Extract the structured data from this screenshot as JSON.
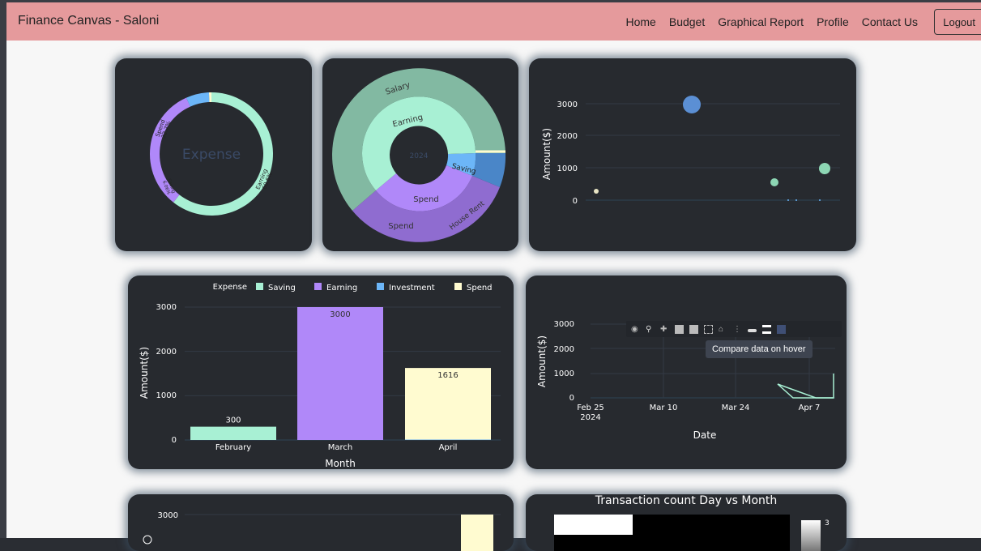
{
  "navbar": {
    "brand": "Finance Canvas - Saloni",
    "links": [
      "Home",
      "Budget",
      "Graphical Report",
      "Profile",
      "Contact Us"
    ],
    "logout": "Logout"
  },
  "charts": {
    "donut": {
      "center_label": "Expense",
      "slices": [
        {
          "label": "Earning",
          "pct": "60.6%",
          "value": 60.6,
          "color": "#a8f0d4"
        },
        {
          "label": "Spend",
          "pct": "32.7%",
          "value": 32.7,
          "color": "#b088f9"
        },
        {
          "label": "Saving",
          "pct": "6.06%",
          "value": 6.06,
          "color": "#6cb6f8"
        },
        {
          "label": "",
          "pct": "",
          "value": 0.64,
          "color": "#fffbd0"
        }
      ]
    },
    "sunburst": {
      "center_label": "2024",
      "labels": {
        "salary": "Salary",
        "earning": "Earning",
        "saving": "Saving",
        "spend_inner": "Spend",
        "spend_outer": "Spend",
        "house_rent": "House Rent"
      }
    },
    "bubble": {
      "ylabel": "Amount($)",
      "yticks": [
        "3000",
        "2000",
        "1000",
        "0"
      ]
    },
    "bar": {
      "legend_title": "Expense",
      "legend": [
        "Saving",
        "Earning",
        "Investment",
        "Spend"
      ],
      "ylabel": "Amount($)",
      "xlabel": "Month",
      "yticks": [
        "3000",
        "2000",
        "1000",
        "0"
      ],
      "categories": [
        "February",
        "March",
        "April"
      ],
      "bar_labels": [
        "300",
        "3000",
        "1616"
      ]
    },
    "line": {
      "ylabel": "Amount($)",
      "xlabel": "Date",
      "yticks": [
        "3000",
        "2000",
        "1000",
        "0"
      ],
      "xticks": [
        "Feb 25",
        "Mar 10",
        "Mar 24",
        "Apr 7"
      ],
      "xtick_year": "2024",
      "tooltip": "Compare data on hover"
    },
    "bottom_left": {
      "ytick": "3000"
    },
    "heatmap": {
      "title": "Transaction count Day vs Month",
      "colorbar_tick": "3"
    }
  },
  "chart_data": [
    {
      "type": "pie",
      "title": "",
      "categories": [
        "Earning",
        "Spend",
        "Saving",
        "Investment"
      ],
      "values": [
        60.6,
        32.7,
        6.06,
        0.64
      ]
    },
    {
      "type": "bar",
      "categories": [
        "February",
        "March",
        "April"
      ],
      "series": [
        {
          "name": "Saving",
          "values": [
            300,
            0,
            0
          ]
        },
        {
          "name": "Earning",
          "values": [
            0,
            3000,
            0
          ]
        },
        {
          "name": "Investment",
          "values": [
            0,
            0,
            10
          ]
        },
        {
          "name": "Spend",
          "values": [
            0,
            0,
            1616
          ]
        }
      ],
      "xlabel": "Month",
      "ylabel": "Amount($)",
      "ylim": [
        0,
        3000
      ]
    },
    {
      "type": "scatter",
      "ylabel": "Amount($)",
      "ylim": [
        0,
        3000
      ]
    }
  ],
  "colors": {
    "saving": "#a8f0d4",
    "earning": "#b088f9",
    "investment": "#6cb6f8",
    "spend": "#fffbd0",
    "card": "#272a2f",
    "navbar": "#e59a9c"
  }
}
